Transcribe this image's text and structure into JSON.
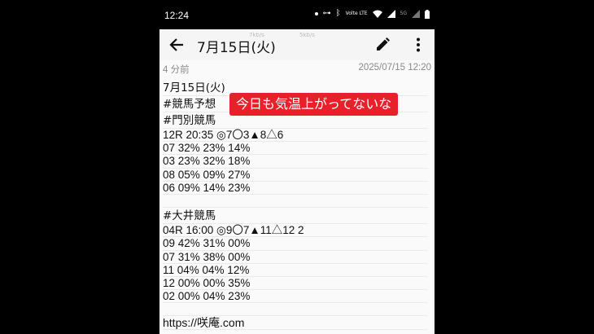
{
  "status_bar": {
    "time": "12:24",
    "network_label": "Volte LTE",
    "network_label_2": "5G",
    "icons": [
      "notification-dot-icon",
      "link-icon",
      "bluetooth-icon",
      "lte-icon",
      "wifi-icon",
      "signal-icon",
      "signal-5g-icon",
      "battery-icon"
    ]
  },
  "app_bar": {
    "title": "7月15日(火)",
    "speed_left": "7kb/s",
    "speed_right": "5kb/s",
    "back_icon": "back-arrow-icon",
    "edit_icon": "pencil-icon",
    "menu_icon": "more-vert-icon"
  },
  "meta": {
    "relative_time": "4 分前",
    "timestamp": "2025/07/15 12:20"
  },
  "note": {
    "lines": [
      {
        "text": "7月15日(火)",
        "kind": "header"
      },
      {
        "text": "#競馬予想",
        "kind": "header"
      },
      {
        "text": "#門別競馬",
        "kind": "header"
      },
      {
        "text": "12R 20:35 ◎7〇3▲8△6",
        "kind": "data"
      },
      {
        "text": "07 32% 23% 14%",
        "kind": "data"
      },
      {
        "text": "03 23% 32% 18%",
        "kind": "data"
      },
      {
        "text": "08 05% 09% 27%",
        "kind": "data"
      },
      {
        "text": "06 09% 14% 23%",
        "kind": "data"
      },
      {
        "text": "",
        "kind": "blank"
      },
      {
        "text": "#大井競馬",
        "kind": "header"
      },
      {
        "text": "04R 16:00 ◎9〇7▲11△12 2",
        "kind": "data"
      },
      {
        "text": "09 42% 31% 00%",
        "kind": "data"
      },
      {
        "text": "07 31% 38% 00%",
        "kind": "data"
      },
      {
        "text": "11 04% 04% 12%",
        "kind": "data"
      },
      {
        "text": "12 00% 00% 35%",
        "kind": "data"
      },
      {
        "text": "02 00% 04% 23%",
        "kind": "data"
      },
      {
        "text": "",
        "kind": "blank"
      },
      {
        "text": "https://咲庵.com",
        "kind": "url"
      }
    ]
  },
  "overlay": {
    "caption": "今日も気温上がってないな",
    "color": "#e8202a"
  }
}
